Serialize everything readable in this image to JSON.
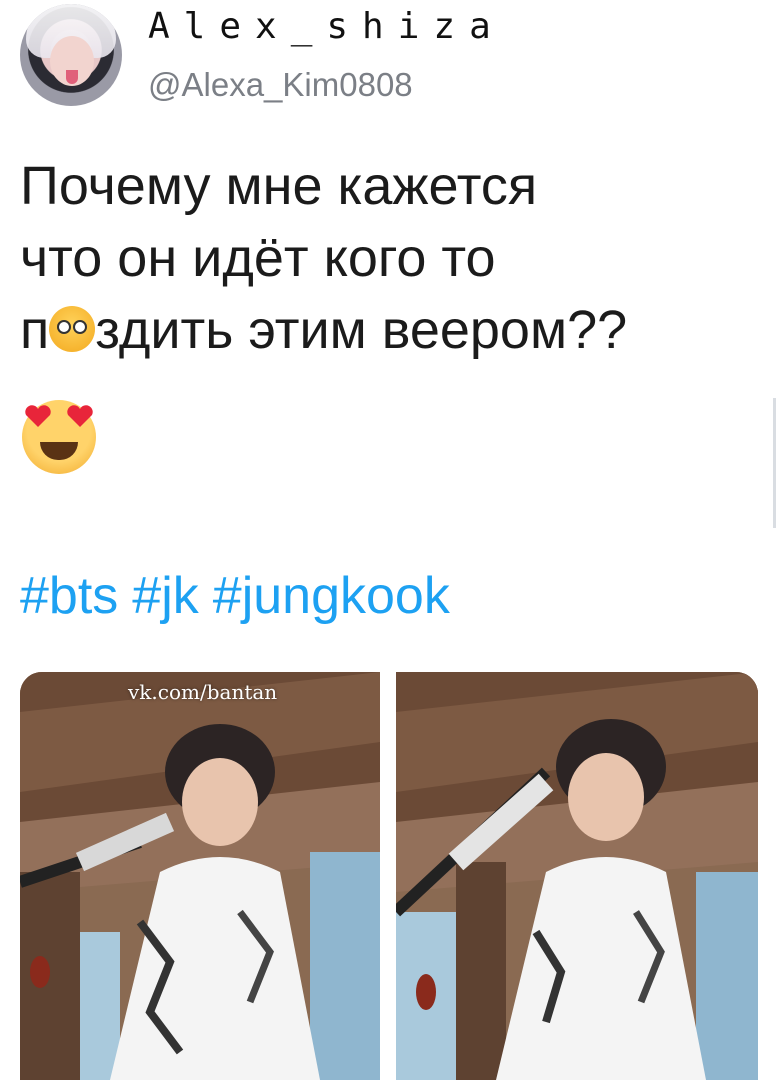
{
  "author": {
    "display_name": "Alex_shiza",
    "handle": "@Alexa_Kim0808"
  },
  "tweet": {
    "lines": [
      "Почему мне кажется",
      "что он идёт кого то"
    ],
    "line3_start": "п",
    "line3_end": "здить этим веером??",
    "hashtags": [
      "#bts",
      "#jk",
      "#jungkook"
    ]
  },
  "media": {
    "watermark": "vk.com/bantan",
    "image1_alt": "photo of a person in a white patterned shirt holding a fan",
    "image2_alt": "photo of a person in a white patterned shirt holding a fan"
  },
  "colors": {
    "hashtag": "#1da1f2",
    "text": "#1b1b1b",
    "handle": "#7b7f86"
  },
  "icons": {
    "inline_emoji": "scream-cat-icon",
    "heart_eyes": "heart-eyes-emoji-icon"
  }
}
